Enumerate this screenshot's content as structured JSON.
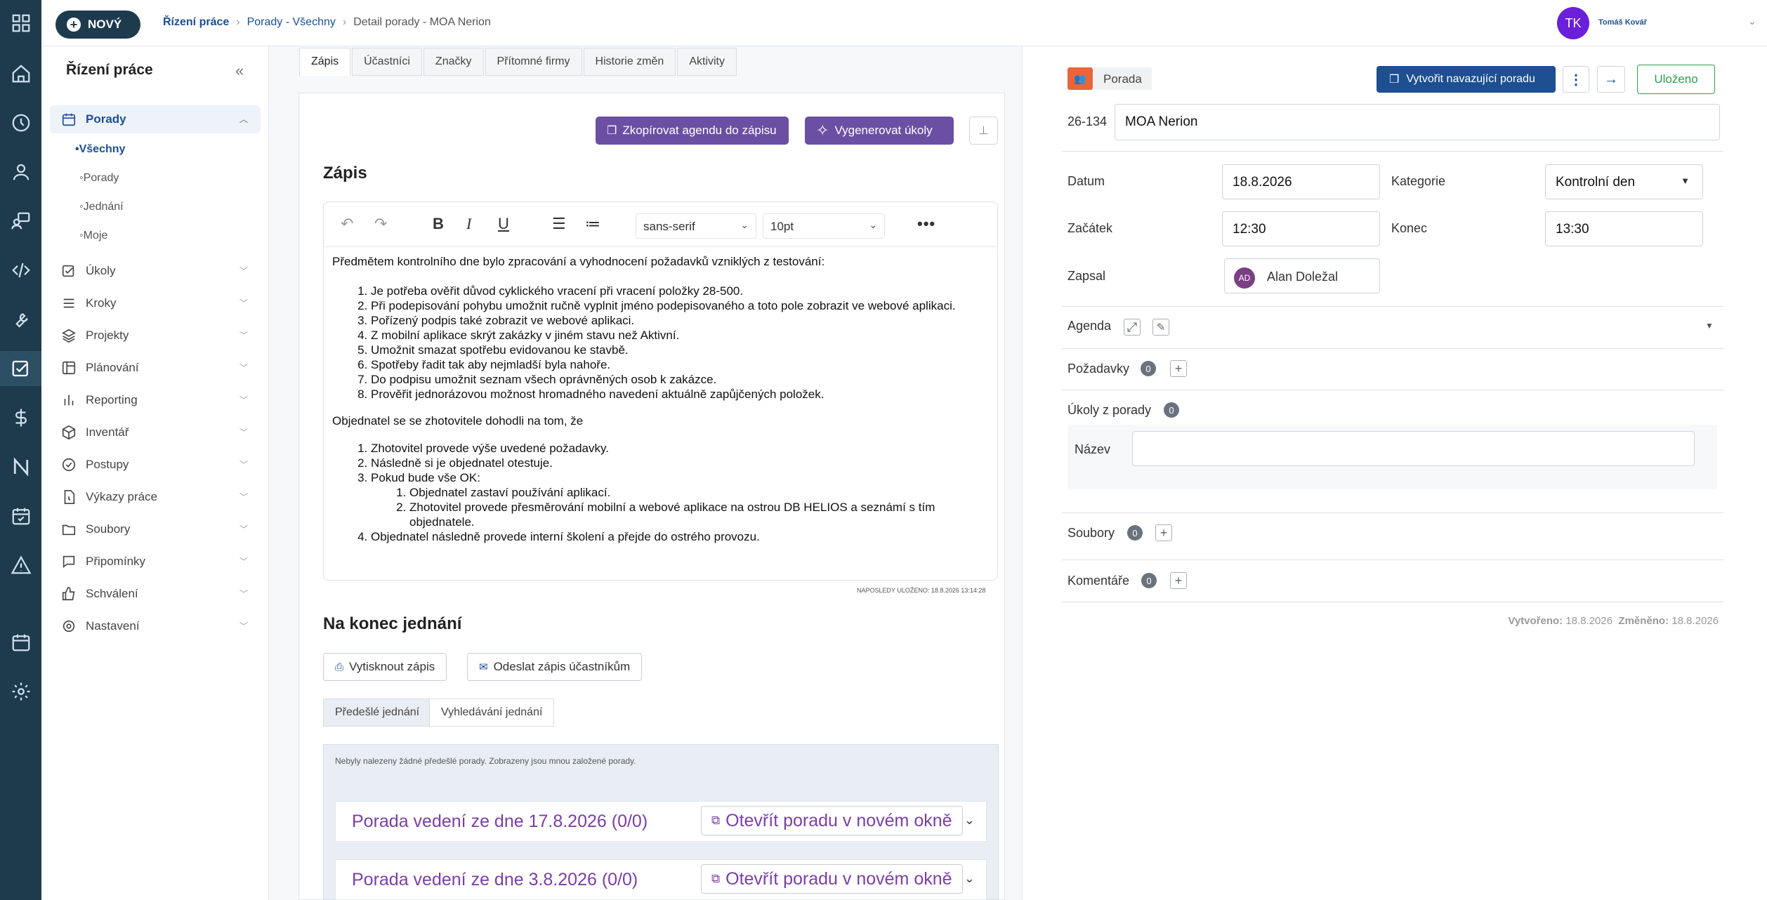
{
  "header": {
    "new_button": "NOVÝ",
    "breadcrumb": [
      "Řízení práce",
      "Porady - Všechny",
      "Detail porady - MOA Nerion"
    ],
    "user_initials": "TK",
    "user_name": "Tomáš Kovář"
  },
  "sidebar": {
    "title": "Řízení práce",
    "items": [
      {
        "label": "Porady",
        "icon": "calendar-icon"
      },
      {
        "label": "Úkoly",
        "icon": "checkbox-icon"
      },
      {
        "label": "Kroky",
        "icon": "list-icon"
      },
      {
        "label": "Projekty",
        "icon": "layers-icon"
      },
      {
        "label": "Plánování",
        "icon": "board-icon"
      },
      {
        "label": "Reporting",
        "icon": "bar-chart-icon"
      },
      {
        "label": "Inventář",
        "icon": "cube-icon"
      },
      {
        "label": "Postupy",
        "icon": "check-circle-icon"
      },
      {
        "label": "Výkazy práce",
        "icon": "file-time-icon"
      },
      {
        "label": "Soubory",
        "icon": "folder-icon"
      },
      {
        "label": "Připomínky",
        "icon": "comment-icon"
      },
      {
        "label": "Schválení",
        "icon": "thumb-up-icon"
      },
      {
        "label": "Nastavení",
        "icon": "gear-icon"
      }
    ],
    "subitems": [
      "•Všechny",
      "Porady",
      "Jednání",
      "Moje"
    ]
  },
  "tabs": [
    "Zápis",
    "Účastníci",
    "Značky",
    "Přítomné firmy",
    "Historie změn",
    "Aktivity"
  ],
  "zapis": {
    "copy_agenda_button": "Zkopírovat agendu do zápisu",
    "generate_tasks_button": "Vygenerovat úkoly",
    "heading": "Zápis",
    "font_family": "sans-serif",
    "font_size": "10pt",
    "intro": "Předmětem kontrolního dne bylo zpracování a vyhodnocení požadavků vzniklých z testování:",
    "list1": [
      "Je potřeba ověřit důvod cyklického vracení při vracení položky 28-500.",
      "Při podepisování pohybu umožnit ručně vyplnit jméno podepisovaného a toto pole zobrazit ve webové aplikaci.",
      "Pořízený podpis také zobrazit ve webové aplikaci.",
      "Z mobilní aplikace skrýt zakázky v jiném stavu než Aktivní.",
      "Umožnit smazat spotřebu evidovanou ke stavbě.",
      "Spotřeby řadit tak aby nejmladší byla nahoře.",
      "Do podpisu umožnit seznam všech oprávněných osob k zakázce.",
      "Prověřit jednorázovou možnost hromadného navedení aktuálně zapůjčených položek."
    ],
    "para2": "Objednatel se se zhotovitele dohodli na tom, že",
    "list2": [
      "Zhotovitel provede výše uvedené požadavky.",
      "Následně si je objednatel otestuje.",
      "Pokud bude vše OK:",
      "Objednatel následně provede interní školení a přejde do ostrého provozu."
    ],
    "list2_sub": [
      "Objednatel zastaví používání aplikací.",
      "Zhotovitel provede přesměrování mobilní a webové aplikace na ostrou DB HELIOS a seznámí s tím objednatele."
    ],
    "saved_note": "NAPOSLEDY ULOŽENO: 18.8.2026 13:14:28"
  },
  "end": {
    "heading": "Na konec jednání",
    "print_button": "Vytisknout zápis",
    "send_button": "Odeslat zápis účastníkům",
    "sub_tabs": [
      "Předešlé jednání",
      "Vyhledávání jednání"
    ],
    "note": "Nebyly nalezeny žádné předešlé porady. Zobrazeny jsou mnou založené porady.",
    "meetings": [
      {
        "title": "Porada vedení ze dne 17.8.2026 (0/0)",
        "open": "Otevřít poradu v novém okně"
      },
      {
        "title": "Porada vedení ze dne 3.8.2026 (0/0)",
        "open": "Otevřít poradu v novém okně"
      }
    ]
  },
  "right": {
    "type_label": "Porada",
    "create_followup_button": "Vytvořit navazující poradu",
    "saved_button": "Uloženo",
    "code": "26-134",
    "name": "MOA Nerion",
    "datum_label": "Datum",
    "datum": "18.8.2026",
    "kategorie_label": "Kategorie",
    "kategorie": "Kontrolní den",
    "zacatek_label": "Začátek",
    "zacatek": "12:30",
    "konec_label": "Konec",
    "konec": "13:30",
    "zapsal_label": "Zapsal",
    "zapsal_initials": "AD",
    "zapsal": "Alan Doležal",
    "agenda_label": "Agenda",
    "pozadavky_label": "Požadavky",
    "pozadavky_count": "0",
    "ukoly_label": "Úkoly z porady",
    "ukoly_count": "0",
    "nazev_label": "Název",
    "soubory_label": "Soubory",
    "soubory_count": "0",
    "komentare_label": "Komentáře",
    "komentare_count": "0",
    "created_label": "Vytvořeno:",
    "created": "18.8.2026",
    "changed_label": "Změněno:",
    "changed": "18.8.2026"
  },
  "colors": {
    "primary": "#1d4f91",
    "rail": "#1e3a4d",
    "purple": "#6b4fa3",
    "orange": "#e8663a",
    "saved_green": "#2e9e4f"
  }
}
